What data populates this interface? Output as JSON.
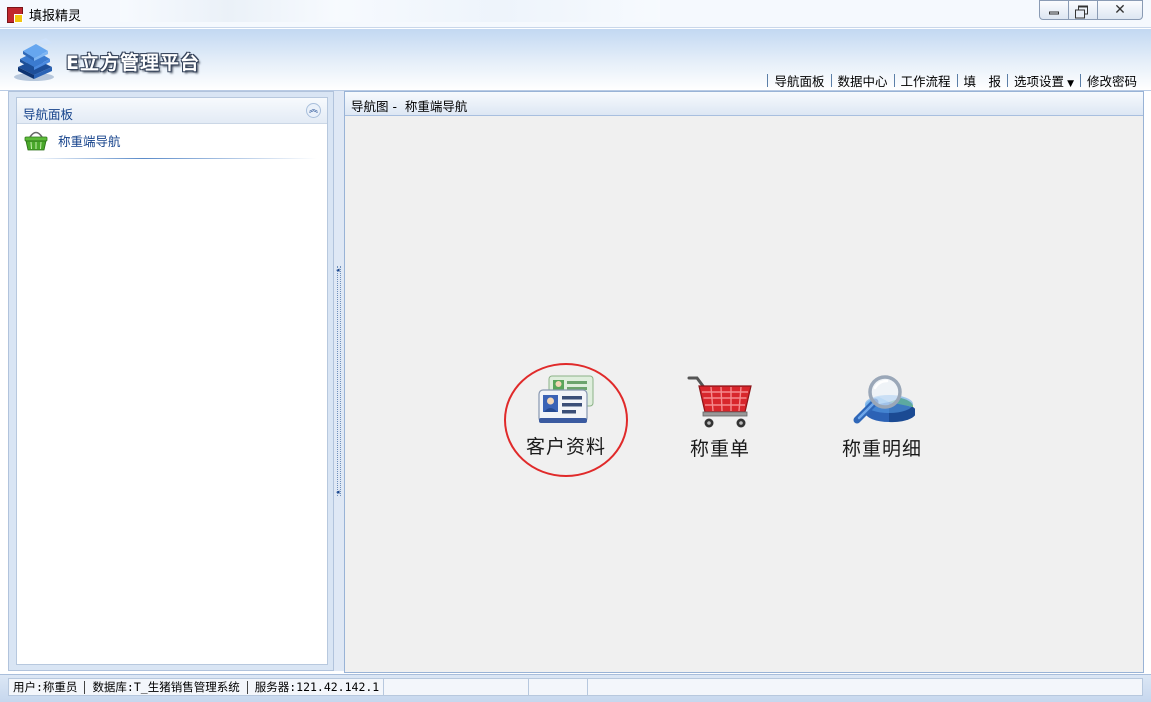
{
  "window": {
    "title": "填报精灵"
  },
  "header": {
    "brand": "E立方管理平台",
    "nav": [
      {
        "label": "导航面板"
      },
      {
        "label": "数据中心"
      },
      {
        "label": "工作流程"
      },
      {
        "label": "填　报"
      },
      {
        "label": "选项设置",
        "has_dropdown": true
      },
      {
        "label": "修改密码"
      }
    ]
  },
  "left_panel": {
    "title": "导航面板",
    "items": [
      {
        "label": "称重端导航",
        "icon": "basket-icon"
      }
    ]
  },
  "main": {
    "title": "导航图 -  称重端导航",
    "tiles": [
      {
        "label": "客户资料",
        "icon": "contact-card-icon",
        "highlighted": true
      },
      {
        "label": "称重单",
        "icon": "shopping-cart-icon"
      },
      {
        "label": "称重明细",
        "icon": "magnifier-chart-icon"
      }
    ]
  },
  "status": {
    "user": "用户:称重员",
    "database": "数据库:T_生猪销售管理系统",
    "server": "服务器:121.42.142.1"
  },
  "colors": {
    "accent": "#15428b",
    "highlight_ring": "#e02a2a"
  }
}
